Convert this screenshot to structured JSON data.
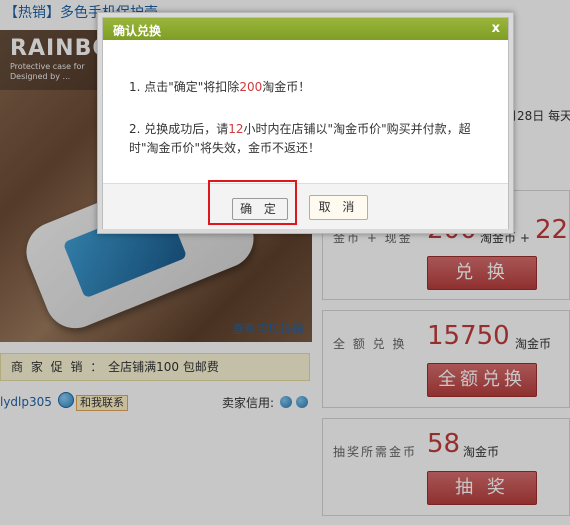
{
  "product": {
    "title": "【热销】多色手机保护壳",
    "image_brand": "RAINBO",
    "image_tagline_1": "Protective case for",
    "image_tagline_2": "Designed by ...",
    "detail_link": "查看宝贝详情",
    "promo_label": "商 家 促 销 ：",
    "promo_text": "全店铺满100 包邮费",
    "seller_name": "lydlp305",
    "contact_label": "和我联系",
    "seller_credit_label": "卖家信用:",
    "date_fragment": "月28日 每天"
  },
  "exchange": {
    "cash_row": {
      "label": "金币 + 现金",
      "points_number": "200",
      "points_unit": "淘金币 +",
      "cash_value": "22",
      "button": "兑 换"
    },
    "full_row": {
      "label": "全 额 兑 换",
      "points_number": "15750",
      "points_unit": "淘金币",
      "button": "全额兑换"
    },
    "lottery_row": {
      "label": "抽奖所需金币",
      "points_number": "58",
      "points_unit": "淘金币",
      "button": "抽 奖"
    }
  },
  "dialog": {
    "title": "确认兑换",
    "close_label": "x",
    "line1_prefix": "1. 点击\"确定\"将扣除",
    "line1_amount": "200",
    "line1_suffix": "淘金币！",
    "line2_prefix": "2. 兑换成功后，请",
    "line2_hours": "12",
    "line2_suffix": "小时内在店铺以\"淘金币价\"购买并付款，超时\"淘金币价\"将失效，金币不返还！",
    "ok_label": "确 定",
    "cancel_label": "取 消"
  },
  "colors": {
    "header_green": "#8aa830",
    "accent_red": "#c03c3c",
    "highlight_red": "#e0161d",
    "link_blue": "#1f64a8"
  }
}
